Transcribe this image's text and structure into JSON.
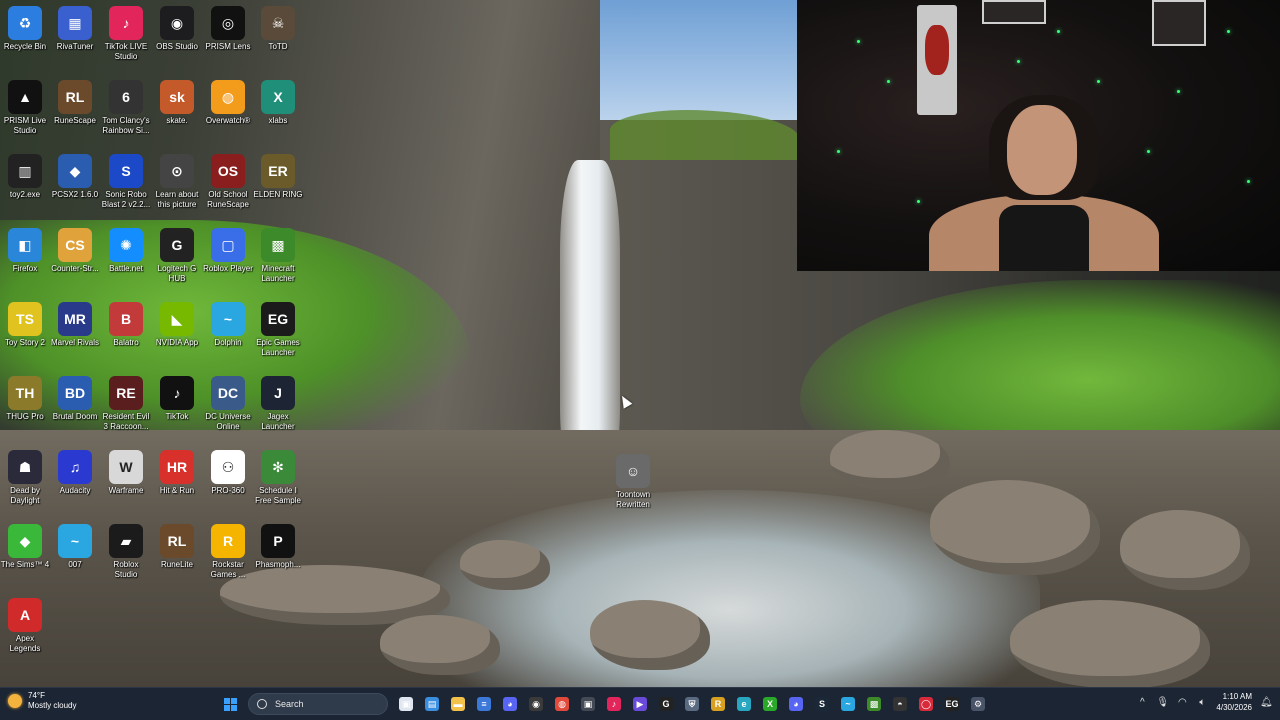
{
  "desktop": {
    "icons": [
      {
        "label": "Recycle Bin",
        "icon": "recycle-bin-icon",
        "color": "#2b7de0",
        "glyph": "♻"
      },
      {
        "label": "RivaTuner",
        "icon": "rivatuner-icon",
        "color": "#3a5fcf",
        "glyph": "▦"
      },
      {
        "label": "TikTok LIVE\nStudio",
        "icon": "tiktok-live-icon",
        "color": "#e2265b",
        "glyph": "♪"
      },
      {
        "label": "OBS Studio",
        "icon": "obs-icon",
        "color": "#1d1d1f",
        "glyph": "◉"
      },
      {
        "label": "PRISM Lens",
        "icon": "prism-lens-icon",
        "color": "#111111",
        "glyph": "◎"
      },
      {
        "label": "ToTD",
        "icon": "totd-icon",
        "color": "#5a4a3a",
        "glyph": "☠"
      },
      {
        "label": "PRISM Live\nStudio",
        "icon": "prism-live-icon",
        "color": "#111111",
        "glyph": "▲"
      },
      {
        "label": "RuneScape",
        "icon": "runescape-icon",
        "color": "#6b4a2c",
        "glyph": "RL"
      },
      {
        "label": "Tom Clancy's\nRainbow Si...",
        "icon": "rainbow-six-icon",
        "color": "#333333",
        "glyph": "6"
      },
      {
        "label": "skate.",
        "icon": "skate-icon",
        "color": "#c45a2a",
        "glyph": "sk"
      },
      {
        "label": "Overwatch®",
        "icon": "overwatch-icon",
        "color": "#f39b1b",
        "glyph": "◍"
      },
      {
        "label": "xlabs",
        "icon": "xlabs-icon",
        "color": "#1f8f7a",
        "glyph": "X"
      },
      {
        "label": "toy2.exe",
        "icon": "toy2-icon",
        "color": "#222222",
        "glyph": "▥"
      },
      {
        "label": "PCSX2 1.6.0",
        "icon": "pcsx2-icon",
        "color": "#2a5db0",
        "glyph": "◆"
      },
      {
        "label": "Sonic Robo\nBlast 2 v2.2...",
        "icon": "sonic-icon",
        "color": "#1c49c7",
        "glyph": "S"
      },
      {
        "label": "Learn about\nthis picture",
        "icon": "learn-picture-icon",
        "color": "#444444",
        "glyph": "⊙"
      },
      {
        "label": "Old School\nRuneScape",
        "icon": "osrs-icon",
        "color": "#8a1d1d",
        "glyph": "OS"
      },
      {
        "label": "ELDEN RING",
        "icon": "elden-ring-icon",
        "color": "#6b5a2a",
        "glyph": "ER"
      },
      {
        "label": "Firefox",
        "icon": "firefox-icon",
        "color": "#2a86d8",
        "glyph": "◧"
      },
      {
        "label": "Counter-Str...",
        "icon": "counter-strike-icon",
        "color": "#e0a23a",
        "glyph": "CS"
      },
      {
        "label": "Battle.net",
        "icon": "battlenet-icon",
        "color": "#148eff",
        "glyph": "✺"
      },
      {
        "label": "Logitech G\nHUB",
        "icon": "logitech-ghub-icon",
        "color": "#222222",
        "glyph": "G"
      },
      {
        "label": "Roblox Player",
        "icon": "roblox-player-icon",
        "color": "#3a6de8",
        "glyph": "▢"
      },
      {
        "label": "Minecraft\nLauncher",
        "icon": "minecraft-icon",
        "color": "#3d8a2b",
        "glyph": "▩"
      },
      {
        "label": "Toy Story 2",
        "icon": "toy-story-icon",
        "color": "#e0c31e",
        "glyph": "TS"
      },
      {
        "label": "Marvel Rivals",
        "icon": "marvel-rivals-icon",
        "color": "#2a3a8a",
        "glyph": "MR"
      },
      {
        "label": "Balatro",
        "icon": "balatro-icon",
        "color": "#c23a3a",
        "glyph": "B"
      },
      {
        "label": "NVIDIA App",
        "icon": "nvidia-icon",
        "color": "#76b900",
        "glyph": "◣"
      },
      {
        "label": "Dolphin",
        "icon": "dolphin-icon",
        "color": "#2aa7e0",
        "glyph": "~"
      },
      {
        "label": "Epic Games\nLauncher",
        "icon": "epic-games-icon",
        "color": "#1b1b1b",
        "glyph": "EG"
      },
      {
        "label": "THUG Pro",
        "icon": "thug-pro-icon",
        "color": "#8a7a2a",
        "glyph": "TH"
      },
      {
        "label": "Brutal Doom",
        "icon": "brutal-doom-icon",
        "color": "#2a5db0",
        "glyph": "BD"
      },
      {
        "label": "Resident Evil\n3 Raccoon...",
        "icon": "resident-evil-icon",
        "color": "#5a1e1e",
        "glyph": "RE"
      },
      {
        "label": "TikTok",
        "icon": "tiktok-icon",
        "color": "#111111",
        "glyph": "♪"
      },
      {
        "label": "DC Universe\nOnline",
        "icon": "dcuo-icon",
        "color": "#3a5a8a",
        "glyph": "DC"
      },
      {
        "label": "Jagex\nLauncher",
        "icon": "jagex-icon",
        "color": "#1d2433",
        "glyph": "J"
      },
      {
        "label": "Dead by\nDaylight",
        "icon": "dead-by-daylight-icon",
        "color": "#2a2a3a",
        "glyph": "☗"
      },
      {
        "label": "Audacity",
        "icon": "audacity-icon",
        "color": "#2a3ad0",
        "glyph": "♫"
      },
      {
        "label": "Warframe",
        "icon": "warframe-icon",
        "color": "#d8d8d8",
        "glyph": "W"
      },
      {
        "label": "Hit & Run",
        "icon": "hit-and-run-icon",
        "color": "#d8302a",
        "glyph": "HR"
      },
      {
        "label": "PRO-360",
        "icon": "pro360-icon",
        "color": "#ffffff",
        "glyph": "⚇"
      },
      {
        "label": "Schedule I\nFree Sample",
        "icon": "schedule-one-icon",
        "color": "#3a8a3a",
        "glyph": "✻"
      },
      {
        "label": "The Sims™ 4",
        "icon": "sims4-icon",
        "color": "#3ab83a",
        "glyph": "◆"
      },
      {
        "label": "007",
        "icon": "007-icon",
        "color": "#2aa7e0",
        "glyph": "~"
      },
      {
        "label": "Roblox\nStudio",
        "icon": "roblox-studio-icon",
        "color": "#1b1b1b",
        "glyph": "▰"
      },
      {
        "label": "RuneLite",
        "icon": "runelite-icon",
        "color": "#6b4a2c",
        "glyph": "RL"
      },
      {
        "label": "Rockstar\nGames ...",
        "icon": "rockstar-icon",
        "color": "#f4b400",
        "glyph": "R"
      },
      {
        "label": "Phasmoph...",
        "icon": "phasmophobia-icon",
        "color": "#111111",
        "glyph": "P"
      },
      {
        "label": "Apex\nLegends",
        "icon": "apex-legends-icon",
        "color": "#d02a2a",
        "glyph": "A"
      },
      {
        "label": "Toontown\nRewritten",
        "icon": "toontown-icon",
        "color": "#6a6a6a",
        "glyph": "☺"
      }
    ]
  },
  "taskbar": {
    "weather": {
      "temp": "74°F",
      "condition": "Mostly cloudy"
    },
    "search_placeholder": "Search",
    "pinned": [
      {
        "icon": "start-icon"
      },
      {
        "icon": "task-view-icon",
        "color": "#dfe6ef",
        "glyph": "▣"
      },
      {
        "icon": "widgets-icon",
        "color": "#3a8ee0",
        "glyph": "▤"
      },
      {
        "icon": "file-explorer-icon",
        "color": "#f2c24a",
        "glyph": "▬"
      },
      {
        "icon": "notepad-icon",
        "color": "#3b78d8",
        "glyph": "≡"
      },
      {
        "icon": "discord-icon",
        "color": "#5865f2",
        "glyph": "◕"
      },
      {
        "icon": "obs-icon",
        "color": "#3a3a3a",
        "glyph": "◉"
      },
      {
        "icon": "chrome-icon",
        "color": "#e14a3b",
        "glyph": "◍"
      },
      {
        "icon": "camera-icon",
        "color": "#444a55",
        "glyph": "▣"
      },
      {
        "icon": "tiktok-live-icon",
        "color": "#e2265b",
        "glyph": "♪"
      },
      {
        "icon": "streamlabs-icon",
        "color": "#6a4ad8",
        "glyph": "▶"
      },
      {
        "icon": "logitech-ghub-icon",
        "color": "#222222",
        "glyph": "G"
      },
      {
        "icon": "shield-icon",
        "color": "#5a6a80",
        "glyph": "⛨"
      },
      {
        "icon": "runelite-icon",
        "color": "#d8a020",
        "glyph": "R"
      },
      {
        "icon": "edge-icon",
        "color": "#2aa7c0",
        "glyph": "e"
      },
      {
        "icon": "xbox-icon",
        "color": "#2aa82a",
        "glyph": "X"
      },
      {
        "icon": "discord-alt-icon",
        "color": "#5865f2",
        "glyph": "◕"
      },
      {
        "icon": "steam-icon",
        "color": "#1b2838",
        "glyph": "S"
      },
      {
        "icon": "dolphin-icon",
        "color": "#2aa7e0",
        "glyph": "~"
      },
      {
        "icon": "minecraft-icon",
        "color": "#3d8a2b",
        "glyph": "▩"
      },
      {
        "icon": "github-icon",
        "color": "#333333",
        "glyph": "◓"
      },
      {
        "icon": "recording-icon",
        "color": "#d82a3a",
        "glyph": "◯"
      },
      {
        "icon": "epic-games-icon",
        "color": "#222222",
        "glyph": "EG"
      },
      {
        "icon": "settings-icon",
        "color": "#4a5468",
        "glyph": "⚙"
      }
    ],
    "tray": {
      "chevron": "^",
      "clock_time": "1:10 AM",
      "clock_date": "4/30/2026"
    }
  }
}
